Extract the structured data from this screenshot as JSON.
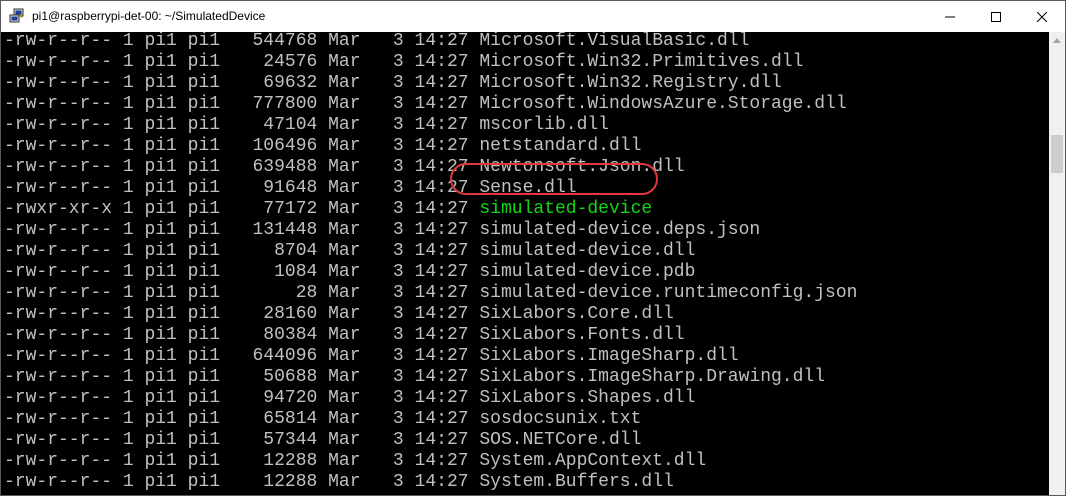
{
  "window": {
    "title": "pi1@raspberrypi-det-00: ~/SimulatedDevice",
    "icon": "putty-icon",
    "controls": [
      "minimize-icon",
      "maximize-icon",
      "close-icon"
    ]
  },
  "colors": {
    "terminal_bg": "#000000",
    "text": "#c0c0c0",
    "executable": "#13d813",
    "highlight": "#e0383b"
  },
  "listing": [
    {
      "perms": "-rw-r--r--",
      "links": "1",
      "owner": "pi1",
      "group": "pi1",
      "size": "544768",
      "month": "Mar",
      "day": "3",
      "time": "14:27",
      "name": "Microsoft.VisualBasic.dll",
      "executable": false
    },
    {
      "perms": "-rw-r--r--",
      "links": "1",
      "owner": "pi1",
      "group": "pi1",
      "size": "24576",
      "month": "Mar",
      "day": "3",
      "time": "14:27",
      "name": "Microsoft.Win32.Primitives.dll",
      "executable": false
    },
    {
      "perms": "-rw-r--r--",
      "links": "1",
      "owner": "pi1",
      "group": "pi1",
      "size": "69632",
      "month": "Mar",
      "day": "3",
      "time": "14:27",
      "name": "Microsoft.Win32.Registry.dll",
      "executable": false
    },
    {
      "perms": "-rw-r--r--",
      "links": "1",
      "owner": "pi1",
      "group": "pi1",
      "size": "777800",
      "month": "Mar",
      "day": "3",
      "time": "14:27",
      "name": "Microsoft.WindowsAzure.Storage.dll",
      "executable": false
    },
    {
      "perms": "-rw-r--r--",
      "links": "1",
      "owner": "pi1",
      "group": "pi1",
      "size": "47104",
      "month": "Mar",
      "day": "3",
      "time": "14:27",
      "name": "mscorlib.dll",
      "executable": false
    },
    {
      "perms": "-rw-r--r--",
      "links": "1",
      "owner": "pi1",
      "group": "pi1",
      "size": "106496",
      "month": "Mar",
      "day": "3",
      "time": "14:27",
      "name": "netstandard.dll",
      "executable": false
    },
    {
      "perms": "-rw-r--r--",
      "links": "1",
      "owner": "pi1",
      "group": "pi1",
      "size": "639488",
      "month": "Mar",
      "day": "3",
      "time": "14:27",
      "name": "Newtonsoft.Json.dll",
      "executable": false
    },
    {
      "perms": "-rw-r--r--",
      "links": "1",
      "owner": "pi1",
      "group": "pi1",
      "size": "91648",
      "month": "Mar",
      "day": "3",
      "time": "14:27",
      "name": "Sense.dll",
      "executable": false
    },
    {
      "perms": "-rwxr-xr-x",
      "links": "1",
      "owner": "pi1",
      "group": "pi1",
      "size": "77172",
      "month": "Mar",
      "day": "3",
      "time": "14:27",
      "name": "simulated-device",
      "executable": true
    },
    {
      "perms": "-rw-r--r--",
      "links": "1",
      "owner": "pi1",
      "group": "pi1",
      "size": "131448",
      "month": "Mar",
      "day": "3",
      "time": "14:27",
      "name": "simulated-device.deps.json",
      "executable": false
    },
    {
      "perms": "-rw-r--r--",
      "links": "1",
      "owner": "pi1",
      "group": "pi1",
      "size": "8704",
      "month": "Mar",
      "day": "3",
      "time": "14:27",
      "name": "simulated-device.dll",
      "executable": false
    },
    {
      "perms": "-rw-r--r--",
      "links": "1",
      "owner": "pi1",
      "group": "pi1",
      "size": "1084",
      "month": "Mar",
      "day": "3",
      "time": "14:27",
      "name": "simulated-device.pdb",
      "executable": false
    },
    {
      "perms": "-rw-r--r--",
      "links": "1",
      "owner": "pi1",
      "group": "pi1",
      "size": "28",
      "month": "Mar",
      "day": "3",
      "time": "14:27",
      "name": "simulated-device.runtimeconfig.json",
      "executable": false
    },
    {
      "perms": "-rw-r--r--",
      "links": "1",
      "owner": "pi1",
      "group": "pi1",
      "size": "28160",
      "month": "Mar",
      "day": "3",
      "time": "14:27",
      "name": "SixLabors.Core.dll",
      "executable": false
    },
    {
      "perms": "-rw-r--r--",
      "links": "1",
      "owner": "pi1",
      "group": "pi1",
      "size": "80384",
      "month": "Mar",
      "day": "3",
      "time": "14:27",
      "name": "SixLabors.Fonts.dll",
      "executable": false
    },
    {
      "perms": "-rw-r--r--",
      "links": "1",
      "owner": "pi1",
      "group": "pi1",
      "size": "644096",
      "month": "Mar",
      "day": "3",
      "time": "14:27",
      "name": "SixLabors.ImageSharp.dll",
      "executable": false
    },
    {
      "perms": "-rw-r--r--",
      "links": "1",
      "owner": "pi1",
      "group": "pi1",
      "size": "50688",
      "month": "Mar",
      "day": "3",
      "time": "14:27",
      "name": "SixLabors.ImageSharp.Drawing.dll",
      "executable": false
    },
    {
      "perms": "-rw-r--r--",
      "links": "1",
      "owner": "pi1",
      "group": "pi1",
      "size": "94720",
      "month": "Mar",
      "day": "3",
      "time": "14:27",
      "name": "SixLabors.Shapes.dll",
      "executable": false
    },
    {
      "perms": "-rw-r--r--",
      "links": "1",
      "owner": "pi1",
      "group": "pi1",
      "size": "65814",
      "month": "Mar",
      "day": "3",
      "time": "14:27",
      "name": "sosdocsunix.txt",
      "executable": false
    },
    {
      "perms": "-rw-r--r--",
      "links": "1",
      "owner": "pi1",
      "group": "pi1",
      "size": "57344",
      "month": "Mar",
      "day": "3",
      "time": "14:27",
      "name": "SOS.NETCore.dll",
      "executable": false
    },
    {
      "perms": "-rw-r--r--",
      "links": "1",
      "owner": "pi1",
      "group": "pi1",
      "size": "12288",
      "month": "Mar",
      "day": "3",
      "time": "14:27",
      "name": "System.AppContext.dll",
      "executable": false
    },
    {
      "perms": "-rw-r--r--",
      "links": "1",
      "owner": "pi1",
      "group": "pi1",
      "size": "12288",
      "month": "Mar",
      "day": "3",
      "time": "14:27",
      "name": "System.Buffers.dll",
      "executable": false
    }
  ]
}
